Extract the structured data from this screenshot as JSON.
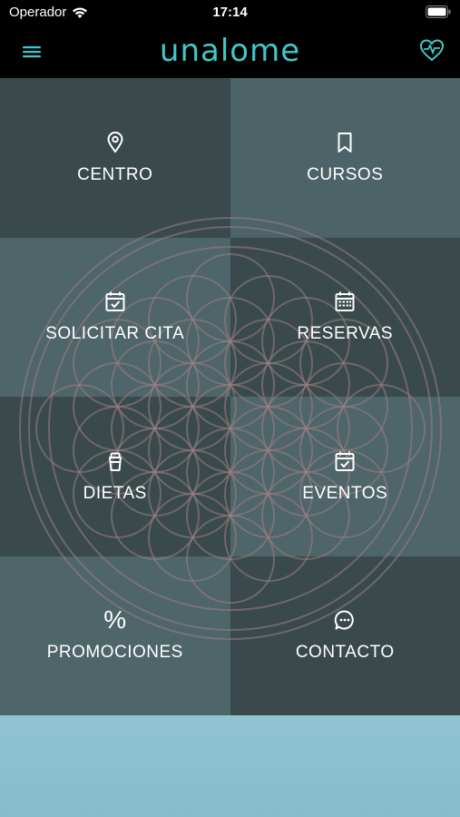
{
  "status": {
    "carrier": "Operador",
    "time": "17:14"
  },
  "header": {
    "logo": "unalome"
  },
  "tiles": [
    {
      "label": "CENTRO",
      "icon": "location-pin-icon"
    },
    {
      "label": "CURSOS",
      "icon": "bookmark-icon"
    },
    {
      "label": "SOLICITAR CITA",
      "icon": "calendar-check-icon"
    },
    {
      "label": "RESERVAS",
      "icon": "calendar-grid-icon"
    },
    {
      "label": "DIETAS",
      "icon": "cup-icon"
    },
    {
      "label": "EVENTOS",
      "icon": "calendar-check-icon"
    },
    {
      "label": "PROMOCIONES",
      "icon": "percent-icon",
      "glyph": "%"
    },
    {
      "label": "CONTACTO",
      "icon": "chat-bubble-icon"
    }
  ],
  "colors": {
    "accent": "#3fc8c8",
    "bottom_panel": "#8fc3d3"
  }
}
